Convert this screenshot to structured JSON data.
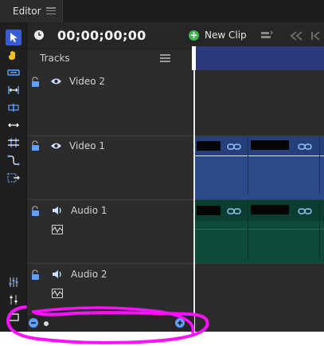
{
  "tab": {
    "label": "Editor"
  },
  "header": {
    "timecode": "00;00;00;00",
    "new_clip_label": "New Clip",
    "tracks_label": "Tracks"
  },
  "tracks": [
    {
      "name": "Video 2",
      "type": "video",
      "icon": "eye-icon"
    },
    {
      "name": "Video 1",
      "type": "video",
      "icon": "eye-icon"
    },
    {
      "name": "Audio 1",
      "type": "audio",
      "icon": "speaker-icon"
    },
    {
      "name": "Audio 2",
      "type": "audio",
      "icon": "speaker-icon"
    }
  ],
  "colors": {
    "accent": "#3a5bd6",
    "video_clip": "#2b4a8a",
    "audio_clip": "#0e4a3a",
    "ruler": "#2a3a7a",
    "highlight": "#ff10ff",
    "new_clip": "#3fb34f"
  },
  "zoom": {
    "level": 0.06
  },
  "tools": [
    "select-tool-icon",
    "hand-tool-icon",
    "razor-tool-icon",
    "ripple-tool-icon",
    "roll-tool-icon",
    "slip-tool-icon",
    "slide-tool-icon",
    "rate-stretch-icon",
    "track-select-icon"
  ],
  "bottom_tools": [
    "mixer-icon",
    "adjust-icon",
    "filter-icon"
  ]
}
